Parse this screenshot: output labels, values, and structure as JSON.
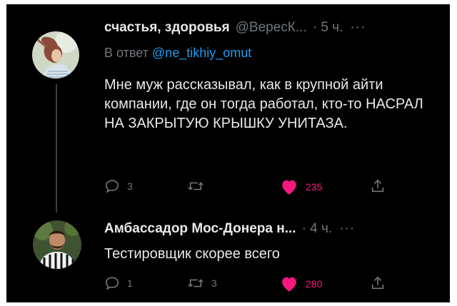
{
  "tweets": [
    {
      "author_name": "счастья, здоровья",
      "handle": "@ВересК...",
      "time": "· 5 ч.",
      "more": "···",
      "reply_prefix": "В ответ",
      "reply_to": "@ne_tikhiy_omut",
      "text": "Мне муж рассказывал, как в крупной айти компании, где он тогда работал, кто-то НАСРАЛ НА ЗАКРЫТУЮ КРЫШКУ УНИТАЗА.",
      "replies": "3",
      "retweets": "",
      "likes": "235",
      "liked": true
    },
    {
      "author_name": "Амбассадор Мос-Донера н...",
      "time": "· 4 ч.",
      "more": "···",
      "text": "Тестировщик скорее всего",
      "replies": "1",
      "retweets": "3",
      "likes": "280",
      "liked": true
    }
  ],
  "colors": {
    "background": "#000000",
    "text": "#e7e9ea",
    "muted": "#71767b",
    "link": "#1d9bf0",
    "like": "#f91880",
    "thread_line": "#3a3d40"
  },
  "icons": [
    "reply-icon",
    "retweet-icon",
    "heart-icon",
    "share-icon"
  ]
}
